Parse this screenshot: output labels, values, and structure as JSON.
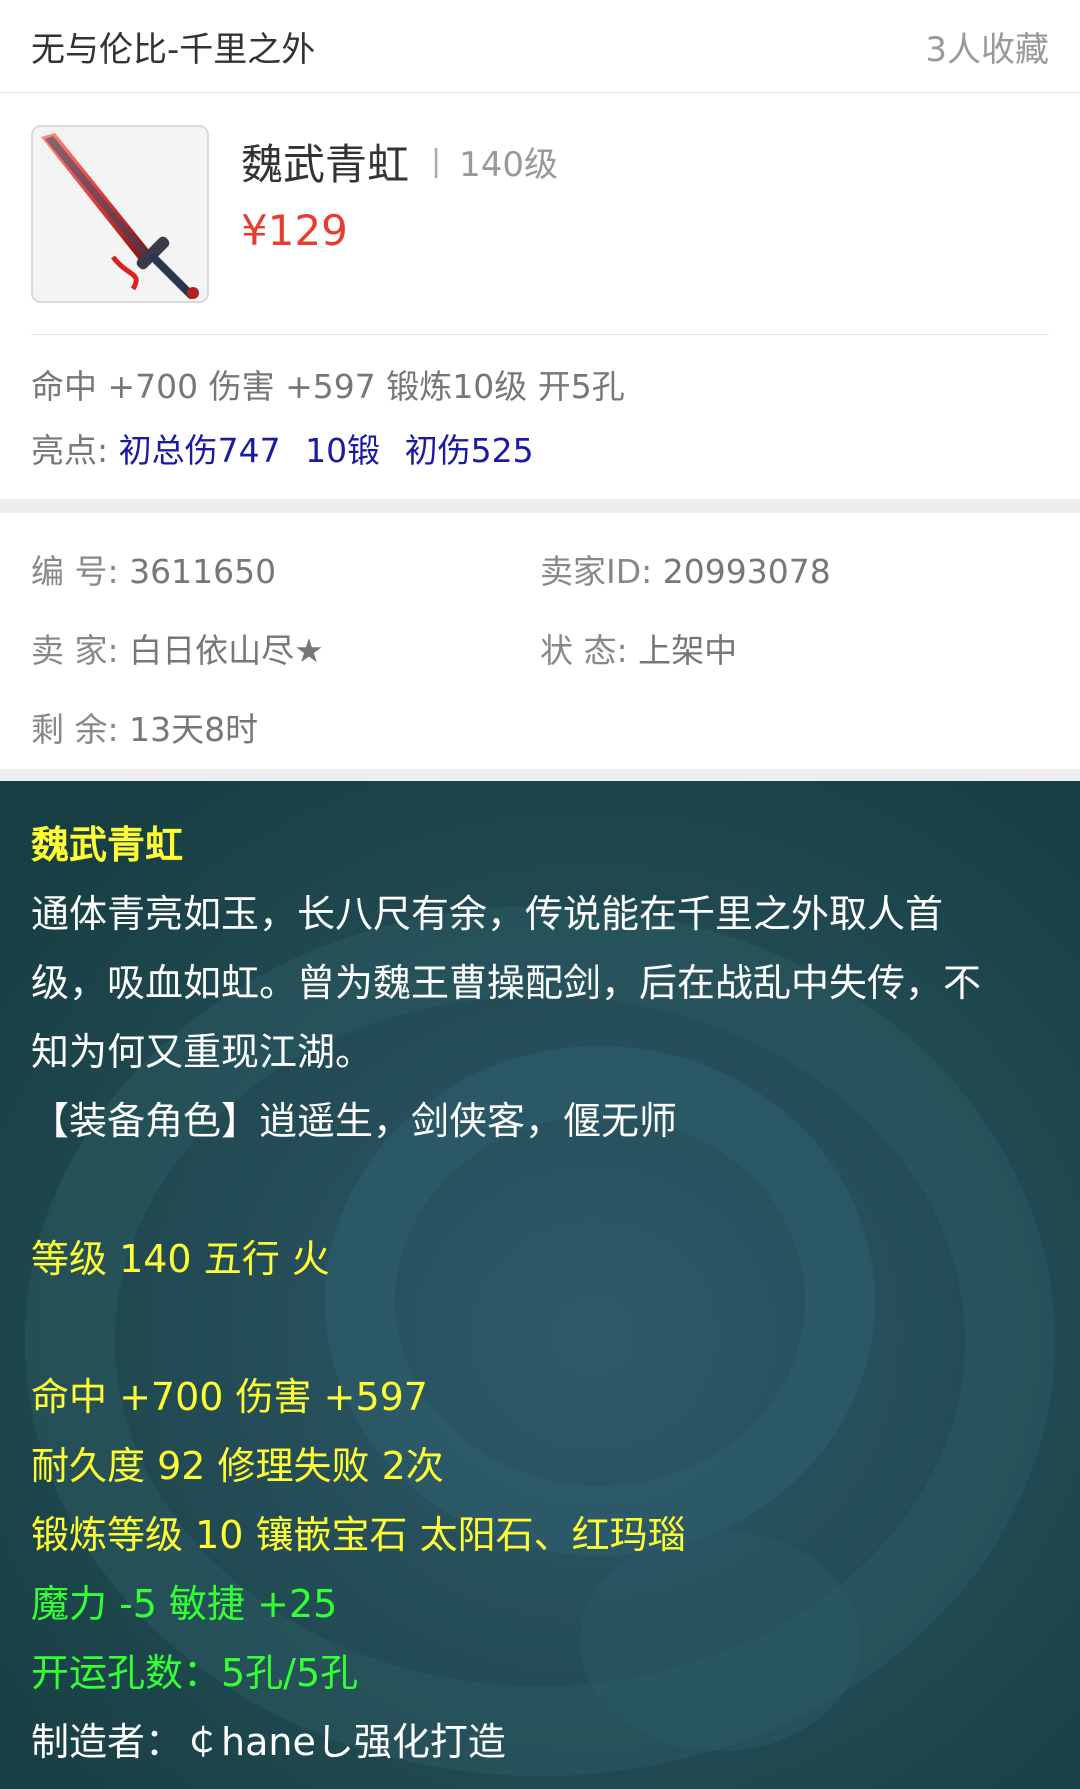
{
  "header": {
    "server": "无与伦比-千里之外",
    "favorites": "3人收藏"
  },
  "item": {
    "name": "魏武青虹",
    "separator": "|",
    "level": "140级",
    "price": "¥129",
    "image_icon": "sword-icon"
  },
  "summary": {
    "stats": "命中 +700 伤害 +597 锻炼10级 开5孔",
    "highlights_label": "亮点:",
    "highlights": [
      "初总伤747",
      "10锻",
      "初伤525"
    ]
  },
  "meta": {
    "number_label": "编  号:",
    "number_value": "3611650",
    "seller_id_label": "卖家ID:",
    "seller_id_value": "20993078",
    "seller_label": "卖  家:",
    "seller_value": "白日依山尽★",
    "status_label": "状  态:",
    "status_value": "上架中",
    "remaining_label": "剩  余:",
    "remaining_value": "13天8时"
  },
  "description": {
    "title": "魏武青虹",
    "lore_1": "通体青亮如玉，长八尺有余，传说能在千里之外取人首",
    "lore_2": "级，吸血如虹。曾为魏王曹操配剑，后在战乱中失传，不",
    "lore_3": "知为何又重现江湖。",
    "roles": "【装备角色】逍遥生，剑侠客，偃无师",
    "level_element": "等级 140 五行 火",
    "attack": "命中 +700 伤害 +597",
    "durability": "耐久度 92 修理失败 2次",
    "forge": "锻炼等级 10 镶嵌宝石 太阳石、红玛瑙",
    "bonus": "魔力 -5 敏捷 +25",
    "holes": "开运孔数：5孔/5孔",
    "maker": "制造者：￠haneし强化打造"
  },
  "colors": {
    "price": "#e63d2e",
    "highlight": "#1a1aa6",
    "desc_bg": "#1f4a4f",
    "yellow": "#ffff33",
    "green": "#33ff33"
  }
}
